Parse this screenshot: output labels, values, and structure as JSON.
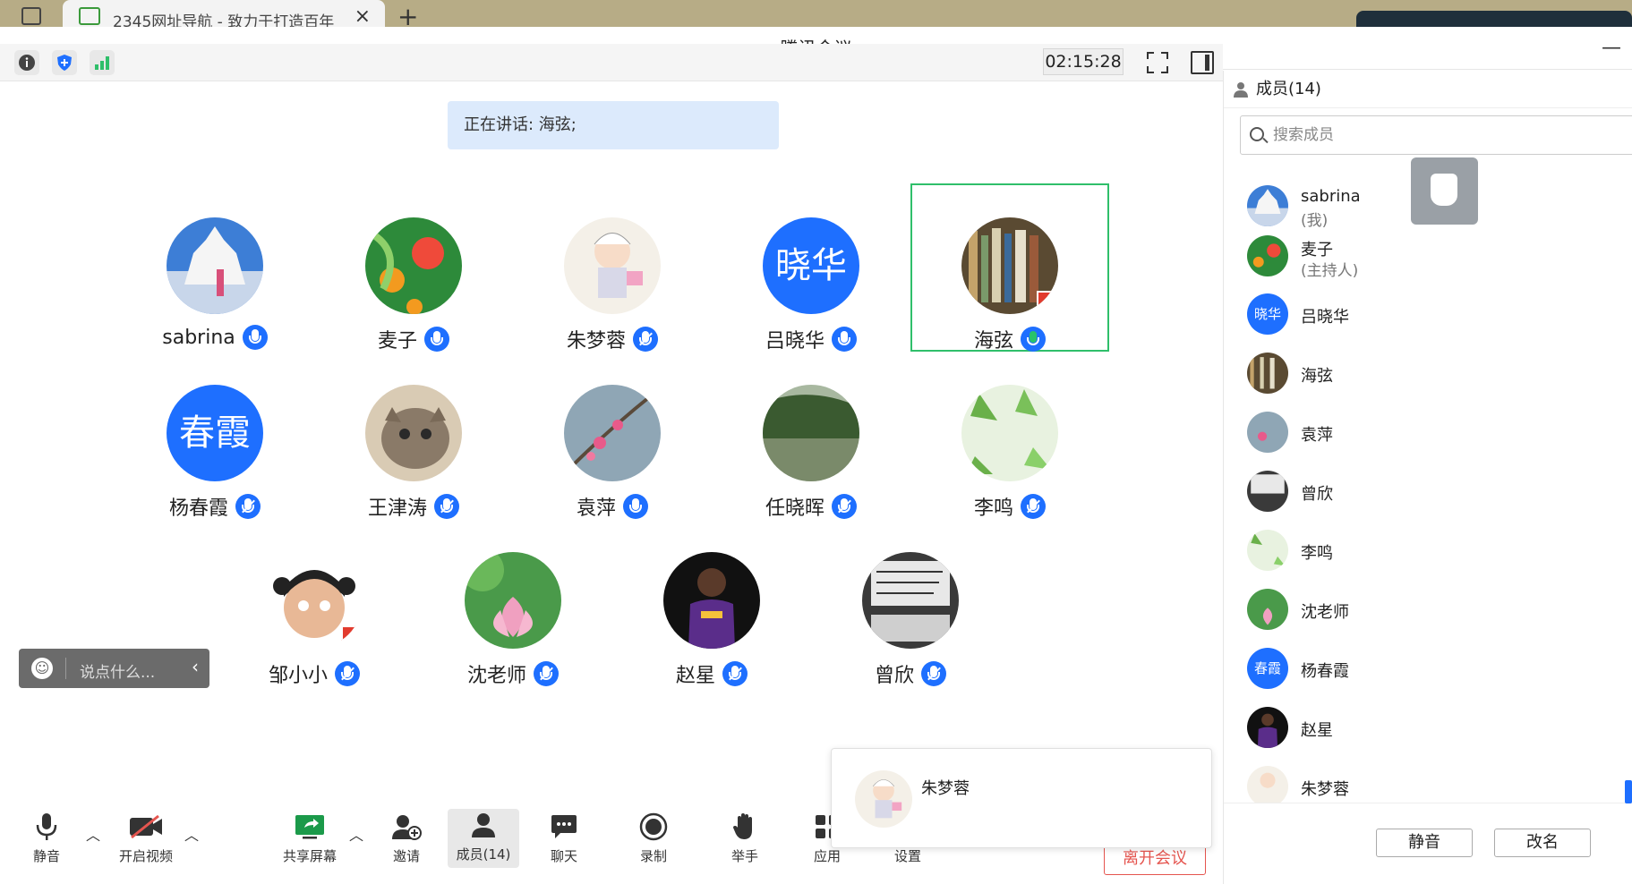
{
  "browser": {
    "tab_title": "2345网址导航 - 致力于打造百年",
    "tab_close": "×",
    "new_tab": "+"
  },
  "window": {
    "title": "腾讯会议",
    "minimize": "—"
  },
  "toolbar": {
    "timer": "02:15:28"
  },
  "speaking": {
    "text": "正在讲话: 海弦;"
  },
  "tiles": [
    {
      "name": "sabrina",
      "mic": "on"
    },
    {
      "name": "麦子",
      "mic": "on"
    },
    {
      "name": "朱梦蓉",
      "mic": "muted"
    },
    {
      "name": "吕晓华",
      "mic": "on",
      "avatar_text": "晓华"
    },
    {
      "name": "海弦",
      "mic": "talking"
    },
    {
      "name": "杨春霞",
      "mic": "muted",
      "avatar_text": "春霞"
    },
    {
      "name": "王津涛",
      "mic": "muted"
    },
    {
      "name": "袁萍",
      "mic": "on"
    },
    {
      "name": "任晓晖",
      "mic": "muted"
    },
    {
      "name": "李鸣",
      "mic": "muted"
    },
    {
      "name": "邹小小",
      "mic": "muted"
    },
    {
      "name": "沈老师",
      "mic": "muted"
    },
    {
      "name": "赵星",
      "mic": "muted"
    },
    {
      "name": "曾欣",
      "mic": "muted"
    }
  ],
  "chat": {
    "placeholder": "说点什么...",
    "collapse": "‹"
  },
  "popup": {
    "name": "朱梦蓉"
  },
  "bottombar": {
    "mute": "静音",
    "video": "开启视频",
    "share": "共享屏幕",
    "invite": "邀请",
    "members": "成员(14)",
    "chat": "聊天",
    "record": "录制",
    "raise": "举手",
    "apps": "应用",
    "settings": "设置",
    "leave": "离开会议"
  },
  "panel": {
    "title": "成员(14)",
    "search_placeholder": "搜索成员",
    "members": [
      {
        "name": "sabrina",
        "sub": "(我)"
      },
      {
        "name": "麦子",
        "sub": "(主持人)"
      },
      {
        "name": "吕晓华",
        "sub": "",
        "avatar_text": "晓华"
      },
      {
        "name": "海弦",
        "sub": ""
      },
      {
        "name": "袁萍",
        "sub": ""
      },
      {
        "name": "曾欣",
        "sub": ""
      },
      {
        "name": "李鸣",
        "sub": ""
      },
      {
        "name": "沈老师",
        "sub": ""
      },
      {
        "name": "杨春霞",
        "sub": "",
        "avatar_text": "春霞"
      },
      {
        "name": "赵星",
        "sub": ""
      },
      {
        "name": "朱梦蓉",
        "sub": ""
      }
    ],
    "mute_btn": "静音",
    "rename_btn": "改名"
  },
  "colors": {
    "accent": "#1e6fff",
    "talking": "#2fbf6a",
    "leave": "#e5554f"
  }
}
